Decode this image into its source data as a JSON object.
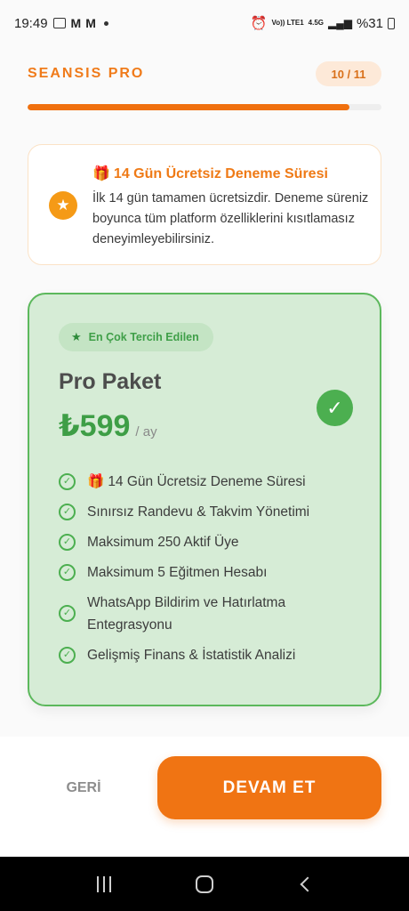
{
  "status_bar": {
    "time": "19:49",
    "network": "Vo)) LTE1",
    "net_gen": "4.5G",
    "battery": "%31"
  },
  "header": {
    "title": "SEANSIS PRO",
    "step": "10 / 11"
  },
  "progress": {
    "value": 0.91,
    "color": "#f0700e"
  },
  "trial": {
    "icon": "star-icon",
    "title": "14 Gün Ücretsiz Deneme Süresi",
    "description": "İlk 14 gün tamamen ücretsizdir. Deneme süreniz boyunca tüm platform özelliklerini kısıtlamasız deneyimleyebilirsiniz."
  },
  "plan": {
    "badge": "En Çok Tercih Edilen",
    "name": "Pro Paket",
    "price": "₺599",
    "period": "/ ay",
    "selected": true,
    "features": [
      "14 Gün Ücretsiz Deneme Süresi",
      "Sınırsız Randevu & Takvim Yönetimi",
      "Maksimum 250 Aktif Üye",
      "Maksimum 5 Eğitmen Hesabı",
      "WhatsApp Bildirim ve Hatırlatma Entegrasyonu",
      "Gelişmiş Finans & İstatistik Analizi"
    ]
  },
  "footer": {
    "back_label": "GERİ",
    "next_label": "DEVAM ET"
  },
  "colors": {
    "accent": "#f07413",
    "success": "#4caf50",
    "plan_bg": "#d6ecd6"
  }
}
